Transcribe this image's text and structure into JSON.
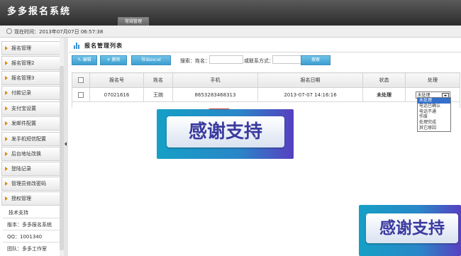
{
  "header": {
    "title": "多多报名系统",
    "tab": "常规管理"
  },
  "timebar": {
    "label": "现在时间：2013年07月07日 06:57:38"
  },
  "sidebar": {
    "items": [
      {
        "label": "报名管理"
      },
      {
        "label": "报名管理2"
      },
      {
        "label": "报名管理3"
      },
      {
        "label": "付款记录"
      },
      {
        "label": "支付宝设置"
      },
      {
        "label": "发邮件配置"
      },
      {
        "label": "发手机短信配置"
      },
      {
        "label": "后台地址改换"
      },
      {
        "label": "登陆记录"
      },
      {
        "label": "管理员修改密码"
      },
      {
        "label": "授权管理"
      }
    ],
    "support_title": "技术支持",
    "version": "版本：多多报名系统",
    "qq": "QQ：1001340",
    "team": "团队：多多工作室"
  },
  "panel": {
    "title": "报名管理列表"
  },
  "toolbar": {
    "edit_label": "编辑",
    "delete_label": "删除",
    "export_label": "导出excel",
    "search_prefix": "搜索：姓名：",
    "contact_label": "或联系方式：",
    "name_value": "",
    "contact_value": "",
    "search_button": "搜索"
  },
  "table": {
    "headers": [
      "",
      "报名号",
      "姓名",
      "手机",
      "报名日期",
      "状态",
      "处理"
    ],
    "rows": [
      {
        "id": "07021616",
        "name": "王婉",
        "phone": "8653283468313",
        "date": "2013-07-07 14:16:16",
        "status": "未处理",
        "action": "未处理"
      }
    ]
  },
  "dropdown": {
    "options": [
      "未处理",
      "电话已确认",
      "电话不通",
      "作废",
      "处理完成",
      "其它原因"
    ],
    "selected_index": 0
  },
  "banners": {
    "text": "感谢支持"
  },
  "colors": {
    "accent": "#3c9ed0",
    "status_red": "#c00000",
    "menu_arrow": "#e08a00"
  }
}
